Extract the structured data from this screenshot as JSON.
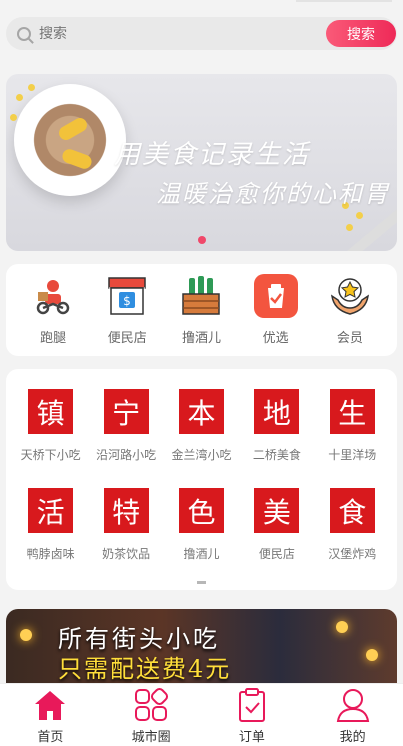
{
  "search": {
    "placeholder": "搜索",
    "button_label": "搜索"
  },
  "banner": {
    "line1": "用美食记录生活",
    "line2": "温暖治愈你的心和胃",
    "active_slide": 1
  },
  "quick_menu": [
    {
      "label": "跑腿",
      "icon": "delivery-rider-icon"
    },
    {
      "label": "便民店",
      "icon": "store-icon"
    },
    {
      "label": "撸酒儿",
      "icon": "beer-crate-icon"
    },
    {
      "label": "优选",
      "icon": "selected-goods-icon"
    },
    {
      "label": "会员",
      "icon": "member-star-icon"
    }
  ],
  "category_grid": [
    {
      "char": "镇",
      "label": "天桥下小吃"
    },
    {
      "char": "宁",
      "label": "沿河路小吃"
    },
    {
      "char": "本",
      "label": "金兰湾小吃"
    },
    {
      "char": "地",
      "label": "二桥美食"
    },
    {
      "char": "生",
      "label": "十里洋场"
    },
    {
      "char": "活",
      "label": "鸭脖卤味"
    },
    {
      "char": "特",
      "label": "奶茶饮品"
    },
    {
      "char": "色",
      "label": "撸酒儿"
    },
    {
      "char": "美",
      "label": "便民店"
    },
    {
      "char": "食",
      "label": "汉堡炸鸡"
    }
  ],
  "promo": {
    "line1": "所有街头小吃",
    "line2": "只需配送费4元"
  },
  "tabbar": [
    {
      "label": "首页",
      "icon": "home-icon",
      "active": true
    },
    {
      "label": "城市圈",
      "icon": "city-circle-icon",
      "active": false
    },
    {
      "label": "订单",
      "icon": "order-clipboard-icon",
      "active": false
    },
    {
      "label": "我的",
      "icon": "profile-icon",
      "active": false
    }
  ],
  "colors": {
    "accent": "#e8195a",
    "tile_red": "#d8191d",
    "search_button": "#f03a63"
  }
}
